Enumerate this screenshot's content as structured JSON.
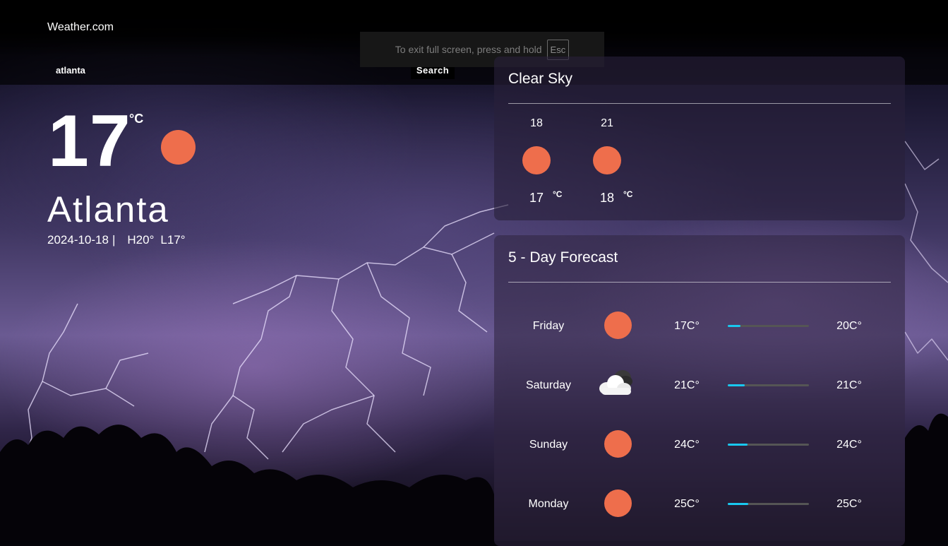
{
  "header": {
    "brand": "Weather.com"
  },
  "search": {
    "value": "atlanta",
    "button_label": "Search"
  },
  "fullscreen_notice": {
    "text": "To exit full screen, press and hold",
    "key": "Esc"
  },
  "current": {
    "temp": "17",
    "unit": "°C",
    "icon": "sun-icon",
    "city": "Atlanta",
    "date": "2024-10-18",
    "separator": "|",
    "high": "H20°",
    "low": "L17°"
  },
  "hourly": {
    "title": "Clear Sky",
    "items": [
      {
        "time": "18",
        "icon": "sun-icon",
        "temp": "17",
        "unit": "°C"
      },
      {
        "time": "21",
        "icon": "sun-icon",
        "temp": "18",
        "unit": "°C"
      }
    ]
  },
  "forecast": {
    "title": "5 - Day Forecast",
    "days": [
      {
        "day": "Friday",
        "icon": "sun-icon",
        "low": "17C°",
        "high": "20C°",
        "range_fraction": 0.16
      },
      {
        "day": "Saturday",
        "icon": "cloud-icon",
        "low": "21C°",
        "high": "21C°",
        "range_fraction": 0.21
      },
      {
        "day": "Sunday",
        "icon": "sun-icon",
        "low": "24C°",
        "high": "24C°",
        "range_fraction": 0.24
      },
      {
        "day": "Monday",
        "icon": "sun-icon",
        "low": "25C°",
        "high": "25C°",
        "range_fraction": 0.25
      }
    ]
  },
  "colors": {
    "sun": "#ee6e4c",
    "range_fill": "#19c8ef",
    "range_track": "#555555"
  }
}
